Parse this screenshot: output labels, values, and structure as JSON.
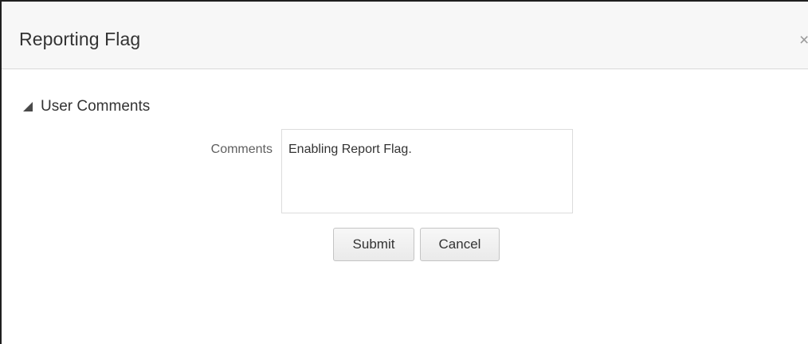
{
  "dialog": {
    "title": "Reporting Flag",
    "close_glyph": "×"
  },
  "section": {
    "title": "User Comments",
    "icon": "triangle-collapse-icon"
  },
  "form": {
    "comments_label": "Comments",
    "comments_value": "Enabling Report Flag."
  },
  "buttons": {
    "submit_label": "Submit",
    "cancel_label": "Cancel"
  },
  "colors": {
    "header_background": "#f7f7f7",
    "border": "#1f1f1f",
    "text": "#333333",
    "label": "#5f5f5f"
  }
}
